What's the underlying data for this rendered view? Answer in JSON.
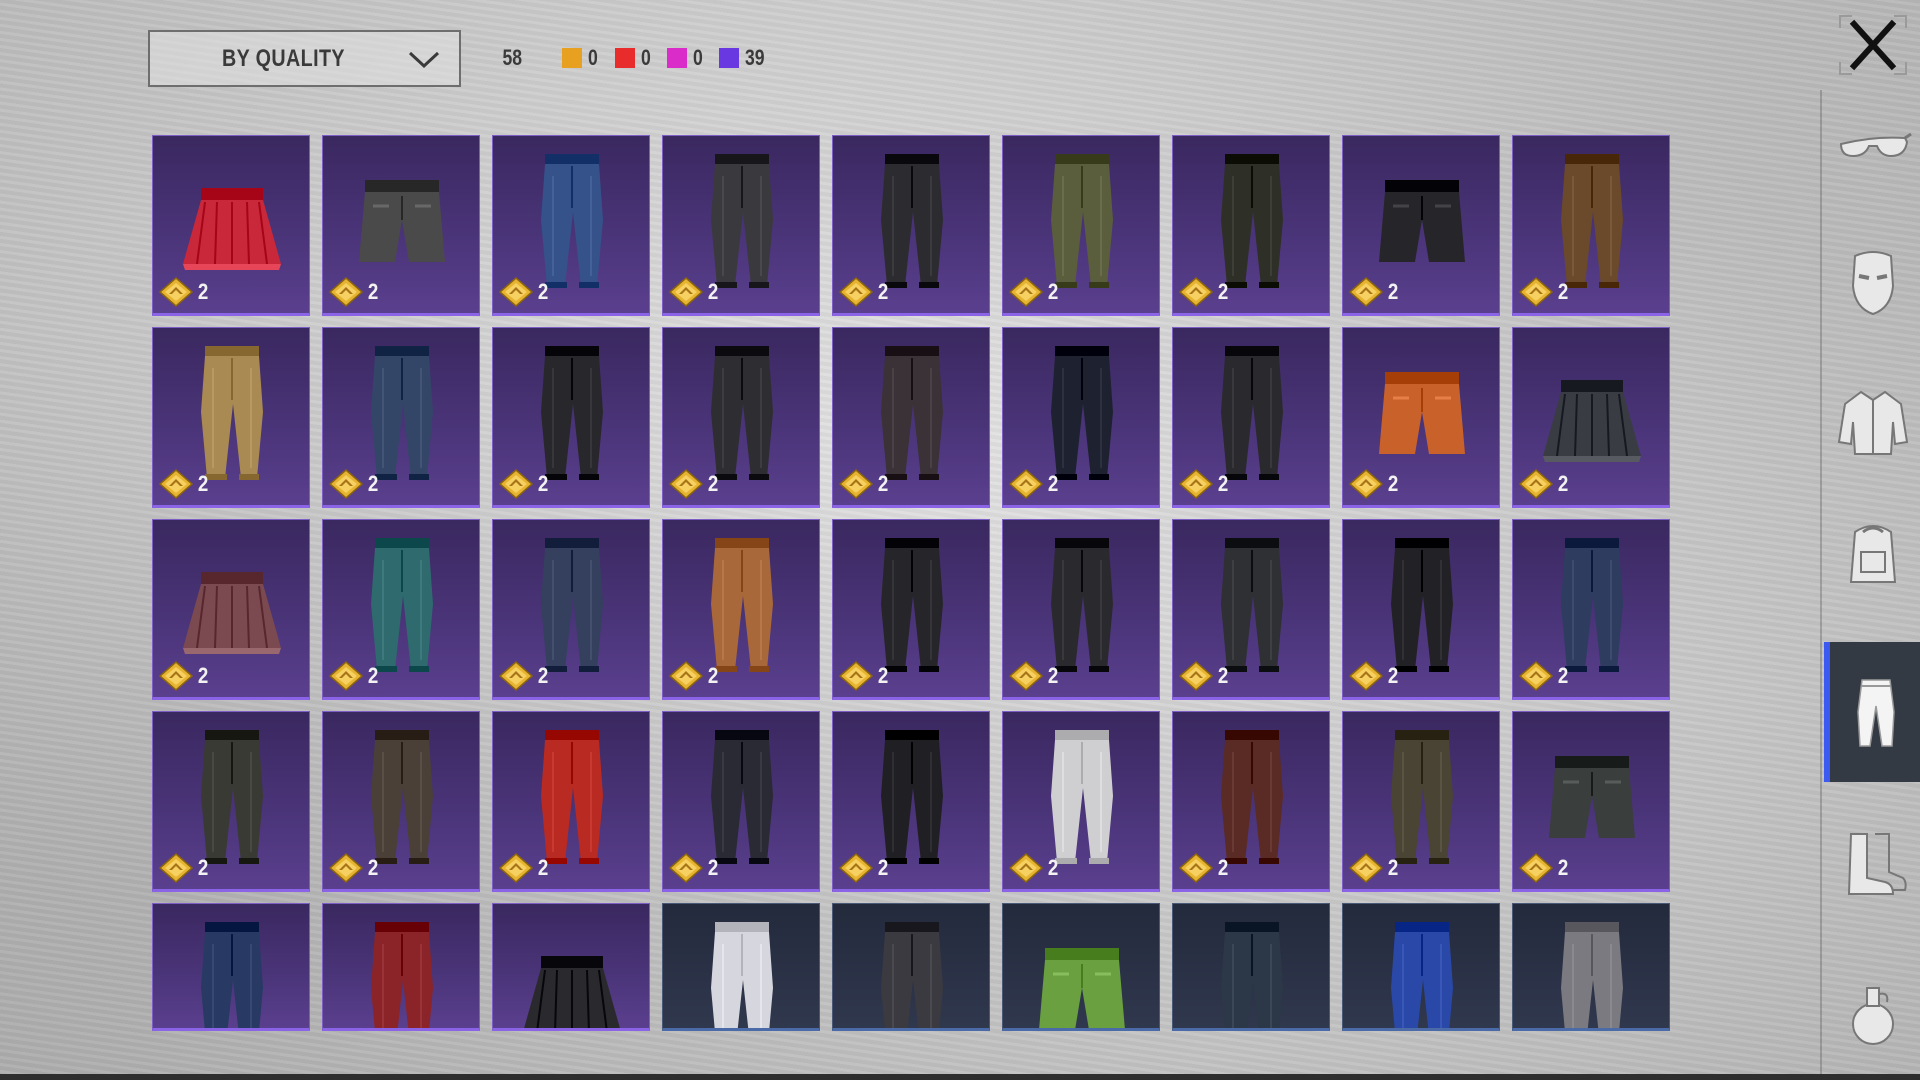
{
  "filter": {
    "label": "BY QUALITY"
  },
  "counts": {
    "total": "58",
    "legend": [
      {
        "color": "#e8a020",
        "value": "0"
      },
      {
        "color": "#e82c2c",
        "value": "0"
      },
      {
        "color": "#d92cc8",
        "value": "0"
      },
      {
        "color": "#6a38e0",
        "value": "39"
      }
    ]
  },
  "colors": {
    "accent": "#3c5af0",
    "epic_border": "#8a63e6",
    "coin": "#e6b430"
  },
  "sidebar": {
    "items": [
      {
        "icon": "glasses-icon",
        "active": false
      },
      {
        "icon": "mask-icon",
        "active": false
      },
      {
        "icon": "jacket-icon",
        "active": false
      },
      {
        "icon": "backpack-icon",
        "active": false
      },
      {
        "icon": "pants-icon",
        "active": true
      },
      {
        "icon": "boots-icon",
        "active": false
      },
      {
        "icon": "grenade-icon",
        "active": false
      }
    ]
  },
  "items": [
    {
      "type": "skirt",
      "color": "#c8283a",
      "price": "2"
    },
    {
      "type": "shorts",
      "color": "#4a4a4a",
      "price": "2"
    },
    {
      "type": "pants",
      "color": "#35528a",
      "price": "2"
    },
    {
      "type": "pants",
      "color": "#3a3a3e",
      "price": "2"
    },
    {
      "type": "pants",
      "color": "#2c2c30",
      "price": "2"
    },
    {
      "type": "pants",
      "color": "#5a5e3c",
      "price": "2"
    },
    {
      "type": "pants",
      "color": "#2e3028",
      "price": "2"
    },
    {
      "type": "shorts",
      "color": "#26262a",
      "price": "2"
    },
    {
      "type": "pants",
      "color": "#6a4a2a",
      "price": "2"
    },
    {
      "type": "pants",
      "color": "#a88a52",
      "price": "2"
    },
    {
      "type": "pants",
      "color": "#344668",
      "price": "2"
    },
    {
      "type": "pants",
      "color": "#28282c",
      "price": "2"
    },
    {
      "type": "pants",
      "color": "#2e2e32",
      "price": "2"
    },
    {
      "type": "pants",
      "color": "#3a3236",
      "price": "2"
    },
    {
      "type": "pants",
      "color": "#1e2230",
      "price": "2"
    },
    {
      "type": "pants",
      "color": "#2a2a2e",
      "price": "2"
    },
    {
      "type": "shorts",
      "color": "#c8622a",
      "price": "2"
    },
    {
      "type": "skirt",
      "color": "#3a3c44",
      "price": "2"
    },
    {
      "type": "skirt",
      "color": "#7a4a50",
      "price": "2"
    },
    {
      "type": "pants",
      "color": "#2e6a6e",
      "price": "2"
    },
    {
      "type": "pants",
      "color": "#34405e",
      "price": "2"
    },
    {
      "type": "pants",
      "color": "#a8683a",
      "price": "2"
    },
    {
      "type": "pants",
      "color": "#26262a",
      "price": "2"
    },
    {
      "type": "pants",
      "color": "#2a2a2e",
      "price": "2"
    },
    {
      "type": "pants",
      "color": "#2e3034",
      "price": "2"
    },
    {
      "type": "pants",
      "color": "#222226",
      "price": "2"
    },
    {
      "type": "pants",
      "color": "#2e3c60",
      "price": "2"
    },
    {
      "type": "pants",
      "color": "#3a3a34",
      "price": "2"
    },
    {
      "type": "pants",
      "color": "#4a4038",
      "price": "2"
    },
    {
      "type": "pants",
      "color": "#b82a22",
      "price": "2"
    },
    {
      "type": "pants",
      "color": "#2a2a34",
      "price": "2"
    },
    {
      "type": "pants",
      "color": "#202024",
      "price": "2"
    },
    {
      "type": "pants",
      "color": "#cfcfd2",
      "price": "2"
    },
    {
      "type": "pants",
      "color": "#5a2a24",
      "price": "2"
    },
    {
      "type": "pants",
      "color": "#4a4434",
      "price": "2"
    },
    {
      "type": "shorts",
      "color": "#3a3e3c",
      "price": "2"
    },
    {
      "type": "pants",
      "color": "#283a64",
      "price": "",
      "tile": "purple"
    },
    {
      "type": "pants",
      "color": "#8a2428",
      "price": "",
      "tile": "purple"
    },
    {
      "type": "skirt",
      "color": "#2a2a2e",
      "price": "",
      "tile": "purple"
    },
    {
      "type": "pants",
      "color": "#d6d6de",
      "price": "",
      "tile": "dark"
    },
    {
      "type": "pants",
      "color": "#3a3a40",
      "price": "",
      "tile": "dark"
    },
    {
      "type": "shorts",
      "color": "#6aa040",
      "price": "",
      "tile": "dark"
    },
    {
      "type": "pants",
      "color": "#2c3848",
      "price": "",
      "tile": "dark"
    },
    {
      "type": "pants",
      "color": "#2a48a8",
      "price": "",
      "tile": "dark"
    },
    {
      "type": "pants",
      "color": "#7a7a80",
      "price": "",
      "tile": "dark"
    }
  ]
}
